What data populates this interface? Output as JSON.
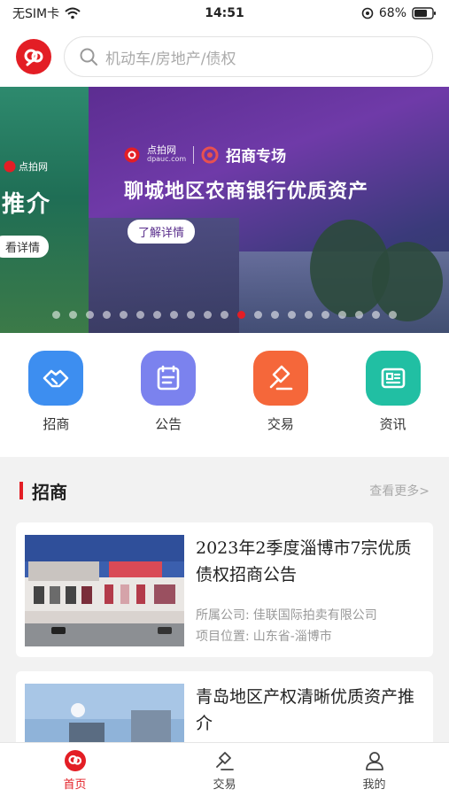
{
  "status_bar": {
    "carrier": "无SIM卡",
    "time": "14:51",
    "battery": "68%"
  },
  "header": {
    "search_placeholder": "机动车/房地产/债权"
  },
  "banner": {
    "left": {
      "brand": "点拍网",
      "title": "推介",
      "button": "看详情"
    },
    "main": {
      "brand_name": "点拍网",
      "brand_url": "dpauc.com",
      "tag": "招商专场",
      "title": "聊城地区农商银行优质资产",
      "button": "了解详情"
    },
    "dot_count": 21,
    "active_dot": 11
  },
  "quick_menu": [
    {
      "label": "招商",
      "icon": "handshake-icon",
      "color": "#3d8ef0"
    },
    {
      "label": "公告",
      "icon": "notice-icon",
      "color": "#7b82ee"
    },
    {
      "label": "交易",
      "icon": "auction-hammer-icon",
      "color": "#f5673a"
    },
    {
      "label": "资讯",
      "icon": "news-icon",
      "color": "#21bfa3"
    }
  ],
  "section": {
    "title": "招商",
    "more": "查看更多>"
  },
  "cards": [
    {
      "title": "2023年2季度淄博市7宗优质债权招商公告",
      "company_label": "所属公司:",
      "company": "佳联国际拍卖有限公司",
      "location_label": "项目位置:",
      "location": "山东省-淄博市"
    },
    {
      "title": "青岛地区产权清晰优质资产推介"
    }
  ],
  "tabbar": [
    {
      "label": "首页",
      "icon": "home-logo-icon",
      "active": true
    },
    {
      "label": "交易",
      "icon": "auction-hammer-icon",
      "active": false
    },
    {
      "label": "我的",
      "icon": "user-icon",
      "active": false
    }
  ],
  "colors": {
    "brand_red": "#e31e25",
    "banner_purple": "#5c2d91"
  }
}
